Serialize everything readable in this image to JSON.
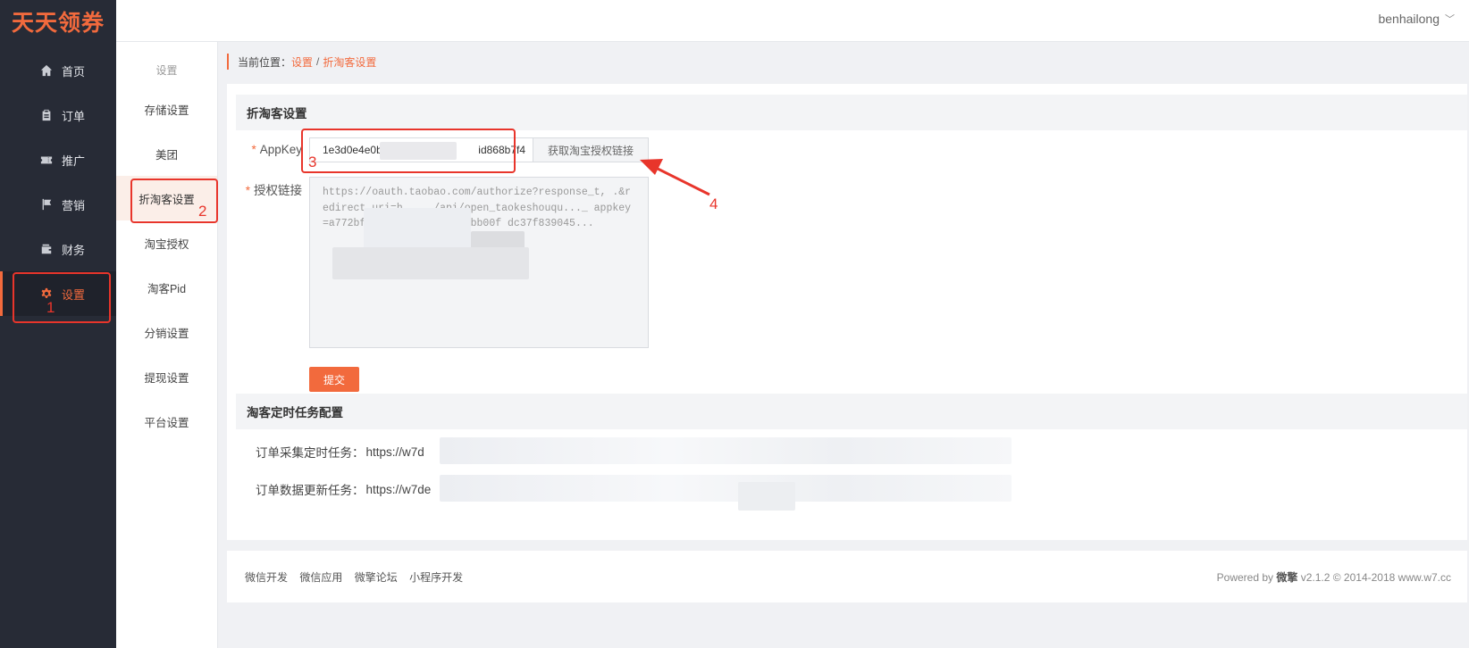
{
  "app": {
    "logo": "天天领券"
  },
  "header": {
    "username": "benhailong"
  },
  "sidebar": {
    "items": [
      {
        "label": "首页",
        "icon": "home-icon"
      },
      {
        "label": "订单",
        "icon": "clipboard-icon"
      },
      {
        "label": "推广",
        "icon": "ticket-icon"
      },
      {
        "label": "营销",
        "icon": "flag-icon"
      },
      {
        "label": "财务",
        "icon": "wallet-icon"
      },
      {
        "label": "设置",
        "icon": "gear-icon",
        "active": true
      }
    ]
  },
  "submenu": {
    "title": "设置",
    "items": [
      "存储设置",
      "美团",
      "折淘客设置",
      "淘宝授权",
      "淘客Pid",
      "分销设置",
      "提现设置",
      "平台设置"
    ],
    "active_index": 2
  },
  "breadcrumb": {
    "prefix": "当前位置：",
    "parent": "设置",
    "separator": "/",
    "current": "折淘客设置"
  },
  "section1": {
    "title": "折淘客设置",
    "appkey_label": "AppKey",
    "appkey_prefix": "1e3d0e4e0b",
    "appkey_suffix": "id868b7f4",
    "appkey_button": "获取淘宝授权链接",
    "authlink_label": "授权链接",
    "authlink_value": "https://oauth.taobao.com/authorize?response_t,          .&redirect_uri=h                   ..../api/open_taokeshouqu..._                           appkey=a772bf....          b28de2ec785abb00f                                dc37f839045...",
    "submit_label": "提交"
  },
  "section2": {
    "title": "淘客定时任务配置",
    "tasks": [
      {
        "label": "订单采集定时任务：",
        "url": "https://w7d"
      },
      {
        "label": "订单数据更新任务：",
        "url": "https://w7de"
      }
    ]
  },
  "footer": {
    "links": [
      "微信开发",
      "微信应用",
      "微擎论坛",
      "小程序开发"
    ],
    "powered_prefix": "Powered by",
    "powered_brand": "微擎",
    "powered_suffix": "v2.1.2 © 2014-2018 www.w7.cc"
  },
  "annotations": [
    "1",
    "2",
    "3",
    "4"
  ],
  "colors": {
    "accent": "#f26a3d",
    "sidebar_bg": "#272b36",
    "annotation": "#e8352b"
  }
}
